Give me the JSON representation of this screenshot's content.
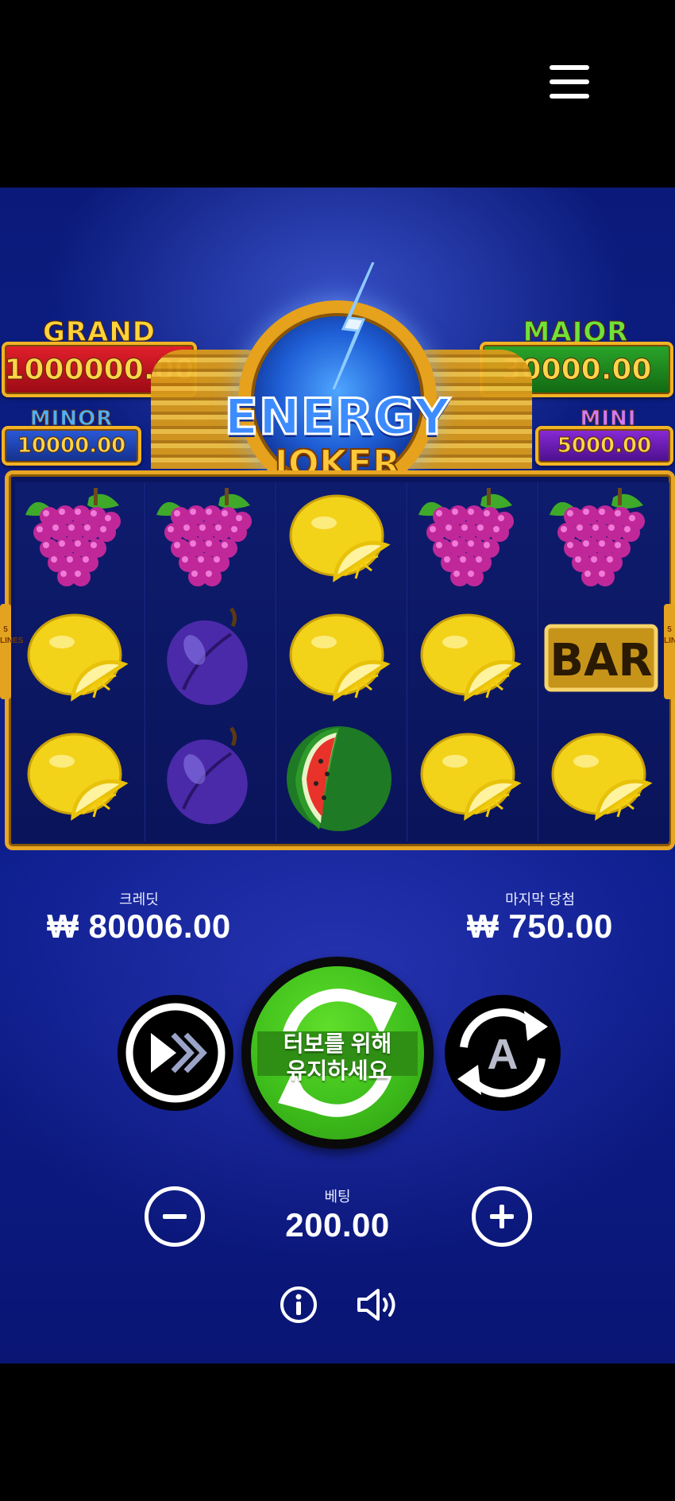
{
  "header": {
    "menu_icon": "hamburger-menu-icon"
  },
  "jackpots": {
    "grand": {
      "title": "GRAND",
      "value": "1000000.00",
      "color": "#c8101c"
    },
    "major": {
      "title": "MAJOR",
      "value": "30000.00",
      "color": "#1f8a1e"
    },
    "minor": {
      "title": "MINOR",
      "value": "10000.00",
      "color": "#1e46c2"
    },
    "mini": {
      "title": "MINI",
      "value": "5000.00",
      "color": "#7a1fc2"
    }
  },
  "logo": {
    "line1": "ENERGY",
    "line2": "JOKER"
  },
  "reels": {
    "columns": [
      [
        "grapes",
        "lemon",
        "lemon"
      ],
      [
        "grapes",
        "plum",
        "plum"
      ],
      [
        "lemon",
        "lemon",
        "watermelon"
      ],
      [
        "grapes",
        "lemon",
        "lemon"
      ],
      [
        "grapes",
        "bar",
        "lemon"
      ]
    ],
    "bar_text": "BAR",
    "side_label": "5 LINES"
  },
  "stats": {
    "credit_label": "크레딧",
    "credit_value": "₩ 80006.00",
    "last_win_label": "마지막 당첨",
    "last_win_value": "₩ 750.00"
  },
  "controls": {
    "turbo_icon": "fast-forward-icon",
    "spin_line1": "터보를 위해",
    "spin_line2": "유지하세요",
    "autoplay_icon": "autoplay-icon",
    "autoplay_letter": "A",
    "bet_label": "베팅",
    "bet_value": "200.00",
    "minus_icon": "minus-icon",
    "plus_icon": "plus-icon",
    "info_icon": "info-icon",
    "sound_icon": "sound-icon"
  }
}
